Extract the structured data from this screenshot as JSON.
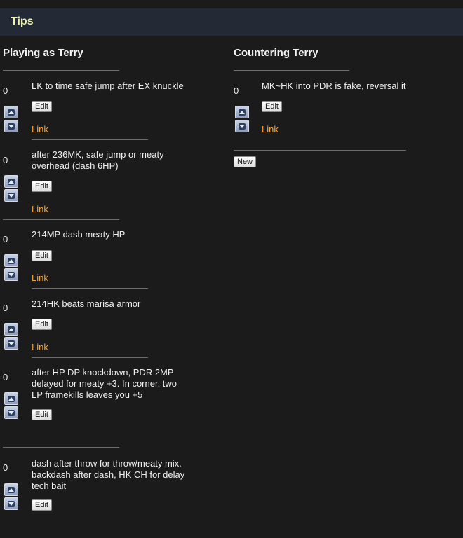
{
  "header": {
    "title": "Tips"
  },
  "left": {
    "title": "Playing as Terry",
    "tips": [
      {
        "score": "0",
        "text": "LK to time safe jump after EX knuckle",
        "edit": "Edit",
        "link": "Link"
      },
      {
        "score": "0",
        "text": "after 236MK, safe jump or meaty overhead (dash 6HP)",
        "edit": "Edit",
        "link": "Link"
      },
      {
        "score": "0",
        "text": "214MP dash meaty HP",
        "edit": "Edit",
        "link": "Link"
      },
      {
        "score": "0",
        "text": "214HK beats marisa armor",
        "edit": "Edit",
        "link": "Link"
      },
      {
        "score": "0",
        "text": "after HP DP knockdown, PDR 2MP delayed for meaty +3. In corner, two LP framekills leaves you +5",
        "edit": "Edit"
      },
      {
        "score": "0",
        "text": "dash after throw for throw/meaty mix. backdash after dash, HK CH for delay tech bait",
        "edit": "Edit"
      }
    ]
  },
  "right": {
    "title": "Countering Terry",
    "tips": [
      {
        "score": "0",
        "text": "MK~HK into PDR is fake, reversal it",
        "edit": "Edit",
        "link": "Link"
      }
    ],
    "new_label": "New"
  },
  "colors": {
    "link": "#f0a23a",
    "header_bg": "#232a36",
    "header_text": "#eef2b0"
  },
  "icons": {
    "upvote": "up-arrow-icon",
    "downvote": "down-arrow-icon"
  }
}
